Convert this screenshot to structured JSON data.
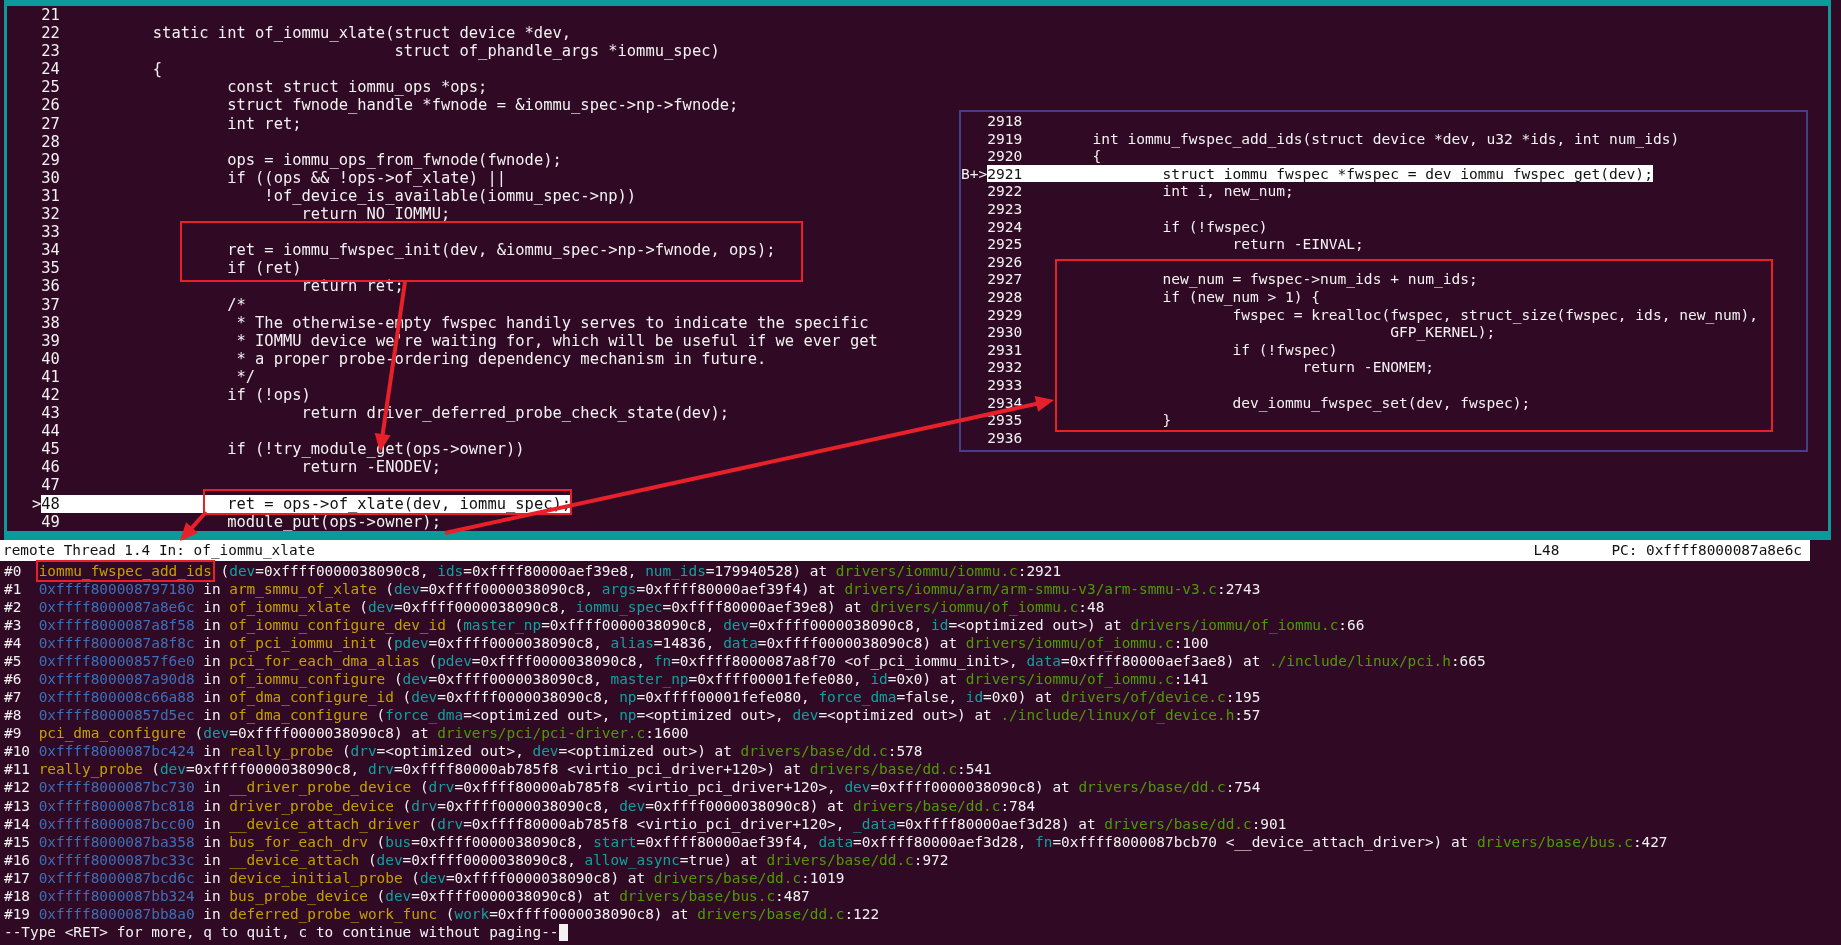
{
  "code_window": {
    "lines": [
      {
        "number": "21",
        "current": false
      },
      {
        "number": "22",
        "code": "        static int of_iommu_xlate(struct device *dev,",
        "current": false
      },
      {
        "number": "23",
        "code": "                                  struct of_phandle_args *iommu_spec)",
        "current": false
      },
      {
        "number": "24",
        "code": "        {",
        "current": false
      },
      {
        "number": "25",
        "code": "                const struct iommu_ops *ops;",
        "current": false
      },
      {
        "number": "26",
        "code": "                struct fwnode_handle *fwnode = &iommu_spec->np->fwnode;",
        "current": false
      },
      {
        "number": "27",
        "code": "                int ret;",
        "current": false
      },
      {
        "number": "28",
        "current": false
      },
      {
        "number": "29",
        "code": "                ops = iommu_ops_from_fwnode(fwnode);",
        "current": false
      },
      {
        "number": "30",
        "code": "                if ((ops && !ops->of_xlate) ||",
        "current": false
      },
      {
        "number": "31",
        "code": "                    !of_device_is_available(iommu_spec->np))",
        "current": false
      },
      {
        "number": "32",
        "code": "                        return NO_IOMMU;",
        "current": false
      },
      {
        "number": "33",
        "current": false
      },
      {
        "number": "34",
        "code": "                ret = iommu_fwspec_init(dev, &iommu_spec->np->fwnode, ops);",
        "current": false
      },
      {
        "number": "35",
        "code": "                if (ret)",
        "current": false
      },
      {
        "number": "36",
        "code": "                        return ret;",
        "current": false
      },
      {
        "number": "37",
        "code": "                /*",
        "current": false
      },
      {
        "number": "38",
        "code": "                 * The otherwise-empty fwspec handily serves to indicate the specific",
        "current": false
      },
      {
        "number": "39",
        "code": "                 * IOMMU device we're waiting for, which will be useful if we ever get",
        "current": false
      },
      {
        "number": "40",
        "code": "                 * a proper probe-ordering dependency mechanism in future.",
        "current": false
      },
      {
        "number": "41",
        "code": "                 */",
        "current": false
      },
      {
        "number": "42",
        "code": "                if (!ops)",
        "current": false
      },
      {
        "number": "43",
        "code": "                        return driver_deferred_probe_check_state(dev);",
        "current": false
      },
      {
        "number": "44",
        "current": false
      },
      {
        "number": "45",
        "code": "                if (!try_module_get(ops->owner))",
        "current": false
      },
      {
        "number": "46",
        "code": "                        return -ENODEV;",
        "current": false
      },
      {
        "number": "47",
        "current": false
      },
      {
        "number": "48",
        "code": "                ret = ops->of_xlate(dev, iommu_spec);",
        "current": true,
        "marker": ">"
      },
      {
        "number": "49",
        "code": "                module_put(ops->owner);",
        "current": false
      }
    ]
  },
  "inset_code": {
    "lines": [
      {
        "number": "2918",
        "current": false
      },
      {
        "number": "2919",
        "code": "        int iommu_fwspec_add_ids(struct device *dev, u32 *ids, int num_ids)",
        "current": false
      },
      {
        "number": "2920",
        "code": "        {",
        "current": false
      },
      {
        "number": "2921",
        "code": "                struct iommu_fwspec *fwspec = dev_iommu_fwspec_get(dev);",
        "current": true,
        "marker": "B+>"
      },
      {
        "number": "2922",
        "code": "                int i, new_num;",
        "current": false
      },
      {
        "number": "2923",
        "current": false
      },
      {
        "number": "2924",
        "code": "                if (!fwspec)",
        "current": false
      },
      {
        "number": "2925",
        "code": "                        return -EINVAL;",
        "current": false
      },
      {
        "number": "2926",
        "current": false
      },
      {
        "number": "2927",
        "code": "                new_num = fwspec->num_ids + num_ids;",
        "current": false
      },
      {
        "number": "2928",
        "code": "                if (new_num > 1) {",
        "current": false
      },
      {
        "number": "2929",
        "code": "                        fwspec = krealloc(fwspec, struct_size(fwspec, ids, new_num),",
        "current": false
      },
      {
        "number": "2930",
        "code": "                                          GFP_KERNEL);",
        "current": false
      },
      {
        "number": "2931",
        "code": "                        if (!fwspec)",
        "current": false
      },
      {
        "number": "2932",
        "code": "                                return -ENOMEM;",
        "current": false
      },
      {
        "number": "2933",
        "current": false
      },
      {
        "number": "2934",
        "code": "                        dev_iommu_fwspec_set(dev, fwspec);",
        "current": false
      },
      {
        "number": "2935",
        "code": "                }",
        "current": false
      },
      {
        "number": "2936",
        "current": false
      }
    ]
  },
  "status_bar": {
    "location": "remote Thread 1.4 In: of_iommu_xlate",
    "line": "L48",
    "pc": "PC: 0xffff8000087a8e6c"
  },
  "backtrace": {
    "frames": [
      {
        "annotated": true,
        "parts": [
          {
            "kind": "plain",
            "text": "#0  "
          },
          {
            "kind": "func",
            "text": "iommu_fwspec_add_ids"
          },
          {
            "kind": "plain",
            "text": " ("
          },
          {
            "kind": "arg",
            "text": "dev"
          },
          {
            "kind": "plain",
            "text": "=0xffff0000038090c8, "
          },
          {
            "kind": "arg",
            "text": "ids"
          },
          {
            "kind": "plain",
            "text": "=0xffff80000aef39e8, "
          },
          {
            "kind": "arg",
            "text": "num_ids"
          },
          {
            "kind": "plain",
            "text": "=179940528) at "
          },
          {
            "kind": "file",
            "text": "drivers/iommu/iommu.c"
          },
          {
            "kind": "plain",
            "text": ":2921"
          }
        ]
      },
      {
        "parts": [
          {
            "kind": "plain",
            "text": "#1  "
          },
          {
            "kind": "addr",
            "text": "0xffff800008797180"
          },
          {
            "kind": "plain",
            "text": " in "
          },
          {
            "kind": "func",
            "text": "arm_smmu_of_xlate"
          },
          {
            "kind": "plain",
            "text": " ("
          },
          {
            "kind": "arg",
            "text": "dev"
          },
          {
            "kind": "plain",
            "text": "=0xffff0000038090c8, "
          },
          {
            "kind": "arg",
            "text": "args"
          },
          {
            "kind": "plain",
            "text": "=0xffff80000aef39f4) at "
          },
          {
            "kind": "file",
            "text": "drivers/iommu/arm/arm-smmu-v3/arm-smmu-v3.c"
          },
          {
            "kind": "plain",
            "text": ":2743"
          }
        ]
      },
      {
        "parts": [
          {
            "kind": "plain",
            "text": "#2  "
          },
          {
            "kind": "addr",
            "text": "0xffff8000087a8e6c"
          },
          {
            "kind": "plain",
            "text": " in "
          },
          {
            "kind": "func",
            "text": "of_iommu_xlate"
          },
          {
            "kind": "plain",
            "text": " ("
          },
          {
            "kind": "arg",
            "text": "dev"
          },
          {
            "kind": "plain",
            "text": "=0xffff0000038090c8, "
          },
          {
            "kind": "arg",
            "text": "iommu_spec"
          },
          {
            "kind": "plain",
            "text": "=0xffff80000aef39e8) at "
          },
          {
            "kind": "file",
            "text": "drivers/iommu/of_iommu.c"
          },
          {
            "kind": "plain",
            "text": ":48"
          }
        ]
      },
      {
        "parts": [
          {
            "kind": "plain",
            "text": "#3  "
          },
          {
            "kind": "addr",
            "text": "0xffff8000087a8f58"
          },
          {
            "kind": "plain",
            "text": " in "
          },
          {
            "kind": "func",
            "text": "of_iommu_configure_dev_id"
          },
          {
            "kind": "plain",
            "text": " ("
          },
          {
            "kind": "arg",
            "text": "master_np"
          },
          {
            "kind": "plain",
            "text": "=0xffff0000038090c8, "
          },
          {
            "kind": "arg",
            "text": "dev"
          },
          {
            "kind": "plain",
            "text": "=0xffff0000038090c8, "
          },
          {
            "kind": "arg",
            "text": "id"
          },
          {
            "kind": "plain",
            "text": "=<optimized out>) at "
          },
          {
            "kind": "file",
            "text": "drivers/iommu/of_iommu.c"
          },
          {
            "kind": "plain",
            "text": ":66"
          }
        ]
      },
      {
        "parts": [
          {
            "kind": "plain",
            "text": "#4  "
          },
          {
            "kind": "addr",
            "text": "0xffff8000087a8f8c"
          },
          {
            "kind": "plain",
            "text": " in "
          },
          {
            "kind": "func",
            "text": "of_pci_iommu_init"
          },
          {
            "kind": "plain",
            "text": " ("
          },
          {
            "kind": "arg",
            "text": "pdev"
          },
          {
            "kind": "plain",
            "text": "=0xffff0000038090c8, "
          },
          {
            "kind": "arg",
            "text": "alias"
          },
          {
            "kind": "plain",
            "text": "=14836, "
          },
          {
            "kind": "arg",
            "text": "data"
          },
          {
            "kind": "plain",
            "text": "=0xffff0000038090c8) at "
          },
          {
            "kind": "file",
            "text": "drivers/iommu/of_iommu.c"
          },
          {
            "kind": "plain",
            "text": ":100"
          }
        ]
      },
      {
        "parts": [
          {
            "kind": "plain",
            "text": "#5  "
          },
          {
            "kind": "addr",
            "text": "0xffff80000857f6e0"
          },
          {
            "kind": "plain",
            "text": " in "
          },
          {
            "kind": "func",
            "text": "pci_for_each_dma_alias"
          },
          {
            "kind": "plain",
            "text": " ("
          },
          {
            "kind": "arg",
            "text": "pdev"
          },
          {
            "kind": "plain",
            "text": "=0xffff0000038090c8, "
          },
          {
            "kind": "arg",
            "text": "fn"
          },
          {
            "kind": "plain",
            "text": "=0xffff8000087a8f70 <of_pci_iommu_init>, "
          },
          {
            "kind": "arg",
            "text": "data"
          },
          {
            "kind": "plain",
            "text": "=0xffff80000aef3ae8) at "
          },
          {
            "kind": "file",
            "text": "./include/linux/pci.h"
          },
          {
            "kind": "plain",
            "text": ":665"
          }
        ]
      },
      {
        "parts": [
          {
            "kind": "plain",
            "text": "#6  "
          },
          {
            "kind": "addr",
            "text": "0xffff8000087a90d8"
          },
          {
            "kind": "plain",
            "text": " in "
          },
          {
            "kind": "func",
            "text": "of_iommu_configure"
          },
          {
            "kind": "plain",
            "text": " ("
          },
          {
            "kind": "arg",
            "text": "dev"
          },
          {
            "kind": "plain",
            "text": "=0xffff0000038090c8, "
          },
          {
            "kind": "arg",
            "text": "master_np"
          },
          {
            "kind": "plain",
            "text": "=0xffff00001fefe080, "
          },
          {
            "kind": "arg",
            "text": "id"
          },
          {
            "kind": "plain",
            "text": "=0x0) at "
          },
          {
            "kind": "file",
            "text": "drivers/iommu/of_iommu.c"
          },
          {
            "kind": "plain",
            "text": ":141"
          }
        ]
      },
      {
        "parts": [
          {
            "kind": "plain",
            "text": "#7  "
          },
          {
            "kind": "addr",
            "text": "0xffff800008c66a88"
          },
          {
            "kind": "plain",
            "text": " in "
          },
          {
            "kind": "func",
            "text": "of_dma_configure_id"
          },
          {
            "kind": "plain",
            "text": " ("
          },
          {
            "kind": "arg",
            "text": "dev"
          },
          {
            "kind": "plain",
            "text": "=0xffff0000038090c8, "
          },
          {
            "kind": "arg",
            "text": "np"
          },
          {
            "kind": "plain",
            "text": "=0xffff00001fefe080, "
          },
          {
            "kind": "arg",
            "text": "force_dma"
          },
          {
            "kind": "plain",
            "text": "=false, "
          },
          {
            "kind": "arg",
            "text": "id"
          },
          {
            "kind": "plain",
            "text": "=0x0) at "
          },
          {
            "kind": "file",
            "text": "drivers/of/device.c"
          },
          {
            "kind": "plain",
            "text": ":195"
          }
        ]
      },
      {
        "parts": [
          {
            "kind": "plain",
            "text": "#8  "
          },
          {
            "kind": "addr",
            "text": "0xffff80000857d5ec"
          },
          {
            "kind": "plain",
            "text": " in "
          },
          {
            "kind": "func",
            "text": "of_dma_configure"
          },
          {
            "kind": "plain",
            "text": " ("
          },
          {
            "kind": "arg",
            "text": "force_dma"
          },
          {
            "kind": "plain",
            "text": "=<optimized out>, "
          },
          {
            "kind": "arg",
            "text": "np"
          },
          {
            "kind": "plain",
            "text": "=<optimized out>, "
          },
          {
            "kind": "arg",
            "text": "dev"
          },
          {
            "kind": "plain",
            "text": "=<optimized out>) at "
          },
          {
            "kind": "file",
            "text": "./include/linux/of_device.h"
          },
          {
            "kind": "plain",
            "text": ":57"
          }
        ]
      },
      {
        "parts": [
          {
            "kind": "plain",
            "text": "#9  "
          },
          {
            "kind": "func",
            "text": "pci_dma_configure"
          },
          {
            "kind": "plain",
            "text": " ("
          },
          {
            "kind": "arg",
            "text": "dev"
          },
          {
            "kind": "plain",
            "text": "=0xffff0000038090c8) at "
          },
          {
            "kind": "file",
            "text": "drivers/pci/pci-driver.c"
          },
          {
            "kind": "plain",
            "text": ":1600"
          }
        ]
      },
      {
        "parts": [
          {
            "kind": "plain",
            "text": "#10 "
          },
          {
            "kind": "addr",
            "text": "0xffff8000087bc424"
          },
          {
            "kind": "plain",
            "text": " in "
          },
          {
            "kind": "func",
            "text": "really_probe"
          },
          {
            "kind": "plain",
            "text": " ("
          },
          {
            "kind": "arg",
            "text": "drv"
          },
          {
            "kind": "plain",
            "text": "=<optimized out>, "
          },
          {
            "kind": "arg",
            "text": "dev"
          },
          {
            "kind": "plain",
            "text": "=<optimized out>) at "
          },
          {
            "kind": "file",
            "text": "drivers/base/dd.c"
          },
          {
            "kind": "plain",
            "text": ":578"
          }
        ]
      },
      {
        "parts": [
          {
            "kind": "plain",
            "text": "#11 "
          },
          {
            "kind": "func",
            "text": "really_probe"
          },
          {
            "kind": "plain",
            "text": " ("
          },
          {
            "kind": "arg",
            "text": "dev"
          },
          {
            "kind": "plain",
            "text": "=0xffff0000038090c8, "
          },
          {
            "kind": "arg",
            "text": "drv"
          },
          {
            "kind": "plain",
            "text": "=0xffff80000ab785f8 <virtio_pci_driver+120>) at "
          },
          {
            "kind": "file",
            "text": "drivers/base/dd.c"
          },
          {
            "kind": "plain",
            "text": ":541"
          }
        ]
      },
      {
        "parts": [
          {
            "kind": "plain",
            "text": "#12 "
          },
          {
            "kind": "addr",
            "text": "0xffff8000087bc730"
          },
          {
            "kind": "plain",
            "text": " in "
          },
          {
            "kind": "func",
            "text": "__driver_probe_device"
          },
          {
            "kind": "plain",
            "text": " ("
          },
          {
            "kind": "arg",
            "text": "drv"
          },
          {
            "kind": "plain",
            "text": "=0xffff80000ab785f8 <virtio_pci_driver+120>, "
          },
          {
            "kind": "arg",
            "text": "dev"
          },
          {
            "kind": "plain",
            "text": "=0xffff0000038090c8) at "
          },
          {
            "kind": "file",
            "text": "drivers/base/dd.c"
          },
          {
            "kind": "plain",
            "text": ":754"
          }
        ]
      },
      {
        "parts": [
          {
            "kind": "plain",
            "text": "#13 "
          },
          {
            "kind": "addr",
            "text": "0xffff8000087bc818"
          },
          {
            "kind": "plain",
            "text": " in "
          },
          {
            "kind": "func",
            "text": "driver_probe_device"
          },
          {
            "kind": "plain",
            "text": " ("
          },
          {
            "kind": "arg",
            "text": "drv"
          },
          {
            "kind": "plain",
            "text": "=0xffff0000038090c8, "
          },
          {
            "kind": "arg",
            "text": "dev"
          },
          {
            "kind": "plain",
            "text": "=0xffff0000038090c8) at "
          },
          {
            "kind": "file",
            "text": "drivers/base/dd.c"
          },
          {
            "kind": "plain",
            "text": ":784"
          }
        ]
      },
      {
        "parts": [
          {
            "kind": "plain",
            "text": "#14 "
          },
          {
            "kind": "addr",
            "text": "0xffff8000087bcc00"
          },
          {
            "kind": "plain",
            "text": " in "
          },
          {
            "kind": "func",
            "text": "__device_attach_driver"
          },
          {
            "kind": "plain",
            "text": " ("
          },
          {
            "kind": "arg",
            "text": "drv"
          },
          {
            "kind": "plain",
            "text": "=0xffff80000ab785f8 <virtio_pci_driver+120>, "
          },
          {
            "kind": "arg",
            "text": "_data"
          },
          {
            "kind": "plain",
            "text": "=0xffff80000aef3d28) at "
          },
          {
            "kind": "file",
            "text": "drivers/base/dd.c"
          },
          {
            "kind": "plain",
            "text": ":901"
          }
        ]
      },
      {
        "parts": [
          {
            "kind": "plain",
            "text": "#15 "
          },
          {
            "kind": "addr",
            "text": "0xffff8000087ba358"
          },
          {
            "kind": "plain",
            "text": " in "
          },
          {
            "kind": "func",
            "text": "bus_for_each_drv"
          },
          {
            "kind": "plain",
            "text": " ("
          },
          {
            "kind": "arg",
            "text": "bus"
          },
          {
            "kind": "plain",
            "text": "=0xffff0000038090c8, "
          },
          {
            "kind": "arg",
            "text": "start"
          },
          {
            "kind": "plain",
            "text": "=0xffff80000aef39f4, "
          },
          {
            "kind": "arg",
            "text": "data"
          },
          {
            "kind": "plain",
            "text": "=0xffff80000aef3d28, "
          },
          {
            "kind": "arg",
            "text": "fn"
          },
          {
            "kind": "plain",
            "text": "=0xffff8000087bcb70 <__device_attach_driver>) at "
          },
          {
            "kind": "file",
            "text": "drivers/base/bus.c"
          },
          {
            "kind": "plain",
            "text": ":427"
          }
        ]
      },
      {
        "parts": [
          {
            "kind": "plain",
            "text": "#16 "
          },
          {
            "kind": "addr",
            "text": "0xffff8000087bc33c"
          },
          {
            "kind": "plain",
            "text": " in "
          },
          {
            "kind": "func",
            "text": "__device_attach"
          },
          {
            "kind": "plain",
            "text": " ("
          },
          {
            "kind": "arg",
            "text": "dev"
          },
          {
            "kind": "plain",
            "text": "=0xffff0000038090c8, "
          },
          {
            "kind": "arg",
            "text": "allow_async"
          },
          {
            "kind": "plain",
            "text": "=true) at "
          },
          {
            "kind": "file",
            "text": "drivers/base/dd.c"
          },
          {
            "kind": "plain",
            "text": ":972"
          }
        ]
      },
      {
        "parts": [
          {
            "kind": "plain",
            "text": "#17 "
          },
          {
            "kind": "addr",
            "text": "0xffff8000087bcd6c"
          },
          {
            "kind": "plain",
            "text": " in "
          },
          {
            "kind": "func",
            "text": "device_initial_probe"
          },
          {
            "kind": "plain",
            "text": " ("
          },
          {
            "kind": "arg",
            "text": "dev"
          },
          {
            "kind": "plain",
            "text": "=0xffff0000038090c8) at "
          },
          {
            "kind": "file",
            "text": "drivers/base/dd.c"
          },
          {
            "kind": "plain",
            "text": ":1019"
          }
        ]
      },
      {
        "parts": [
          {
            "kind": "plain",
            "text": "#18 "
          },
          {
            "kind": "addr",
            "text": "0xffff8000087bb324"
          },
          {
            "kind": "plain",
            "text": " in "
          },
          {
            "kind": "func",
            "text": "bus_probe_device"
          },
          {
            "kind": "plain",
            "text": " ("
          },
          {
            "kind": "arg",
            "text": "dev"
          },
          {
            "kind": "plain",
            "text": "=0xffff0000038090c8) at "
          },
          {
            "kind": "file",
            "text": "drivers/base/bus.c"
          },
          {
            "kind": "plain",
            "text": ":487"
          }
        ]
      },
      {
        "parts": [
          {
            "kind": "plain",
            "text": "#19 "
          },
          {
            "kind": "addr",
            "text": "0xffff8000087bb8a0"
          },
          {
            "kind": "plain",
            "text": " in "
          },
          {
            "kind": "func",
            "text": "deferred_probe_work_func"
          },
          {
            "kind": "plain",
            "text": " ("
          },
          {
            "kind": "arg",
            "text": "work"
          },
          {
            "kind": "plain",
            "text": "=0xffff0000038090c8) at "
          },
          {
            "kind": "file",
            "text": "drivers/base/dd.c"
          },
          {
            "kind": "plain",
            "text": ":122"
          }
        ]
      }
    ]
  },
  "pager_prompt": "--Type <RET> for more, q to quit, c to continue without paging--"
}
